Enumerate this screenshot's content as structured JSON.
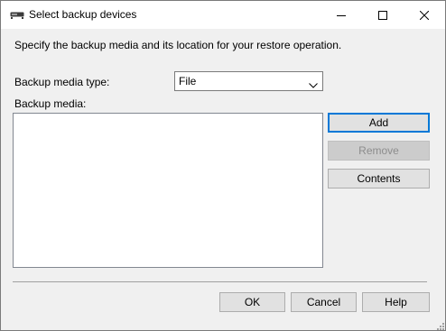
{
  "window": {
    "title": "Select backup devices",
    "icon": "backup-device-icon",
    "controls": [
      "minimize-icon",
      "maximize-icon",
      "close-icon"
    ]
  },
  "dialog": {
    "description": "Specify the backup media and its location for your restore operation.",
    "media_type_label": "Backup media type:",
    "media_type_value": "File",
    "media_label": "Backup media:",
    "media_items": []
  },
  "buttons": {
    "add": "Add",
    "remove": "Remove",
    "contents": "Contents",
    "ok": "OK",
    "cancel": "Cancel",
    "help": "Help"
  },
  "states": {
    "remove_enabled": false,
    "add_is_default": true
  },
  "colors": {
    "focus_border": "#0078d7",
    "button_face": "#e1e1e1",
    "dialog_background": "#f0f0f0"
  }
}
